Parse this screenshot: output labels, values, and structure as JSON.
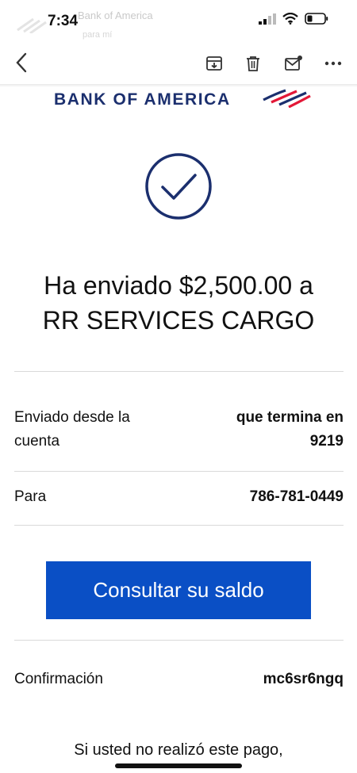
{
  "status": {
    "time": "7:34",
    "ghost_sender": "Bank of America",
    "ghost_subtitle": "para mí",
    "icons": [
      "signal-icon",
      "wifi-icon",
      "battery-icon"
    ]
  },
  "toolbar": {
    "icons": [
      "back-icon",
      "archive-icon",
      "trash-icon",
      "mark-unread-icon",
      "more-icon"
    ]
  },
  "brand": {
    "name": "BANK OF AMERICA",
    "colors": {
      "navy": "#1b2f6e",
      "red": "#e31837"
    }
  },
  "message": {
    "line1": "Ha enviado $2,500.00 a",
    "line2": "RR SERVICES CARGO"
  },
  "details": {
    "from_label_1": "Enviado desde la",
    "from_label_2": "cuenta",
    "from_value_1": "que termina en",
    "from_value_2": "9219",
    "to_label": "Para",
    "to_value": "786-781-0449",
    "confirmation_label": "Confirmación",
    "confirmation_value": "mc6sr6ngq"
  },
  "cta": {
    "label": "Consultar su saldo",
    "color": "#0a4fc5"
  },
  "footer": {
    "text": "Si usted no realizó este pago,"
  }
}
